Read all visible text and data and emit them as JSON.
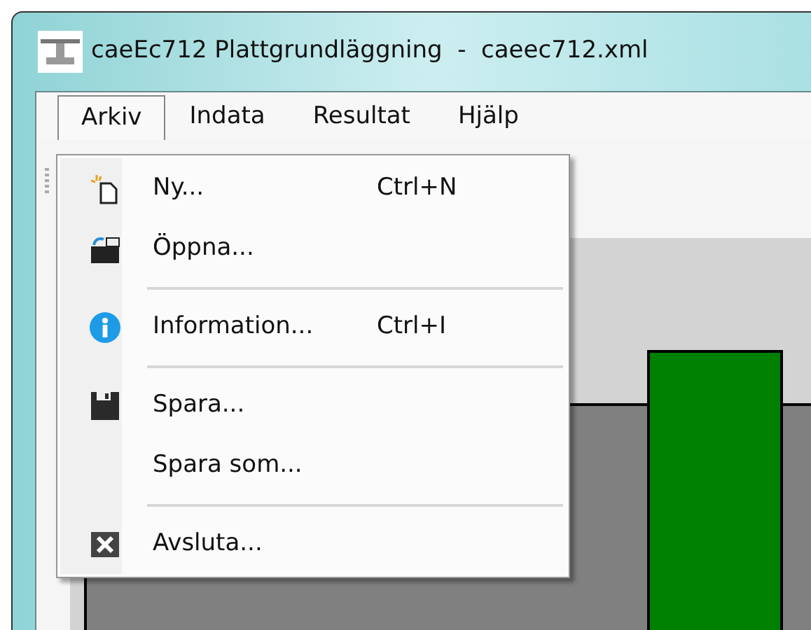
{
  "window": {
    "title": "caeEc712 Plattgrundläggning  -  caeec712.xml"
  },
  "menu_bar": [
    {
      "label": "Arkiv",
      "selected": true
    },
    {
      "label": "Indata",
      "selected": false
    },
    {
      "label": "Resultat",
      "selected": false
    },
    {
      "label": "Hjälp",
      "selected": false
    }
  ],
  "open_menu": {
    "items": [
      {
        "kind": "item",
        "label": "Ny...",
        "shortcut": "Ctrl+N"
      },
      {
        "kind": "item",
        "label": "Öppna..."
      },
      {
        "kind": "separator"
      },
      {
        "kind": "item",
        "label": "Information...",
        "shortcut": "Ctrl+I"
      },
      {
        "kind": "separator"
      },
      {
        "kind": "item",
        "label": "Spara..."
      },
      {
        "kind": "item",
        "label": "Spara som..."
      },
      {
        "kind": "separator"
      },
      {
        "kind": "item",
        "label": "Avsluta..."
      }
    ]
  }
}
